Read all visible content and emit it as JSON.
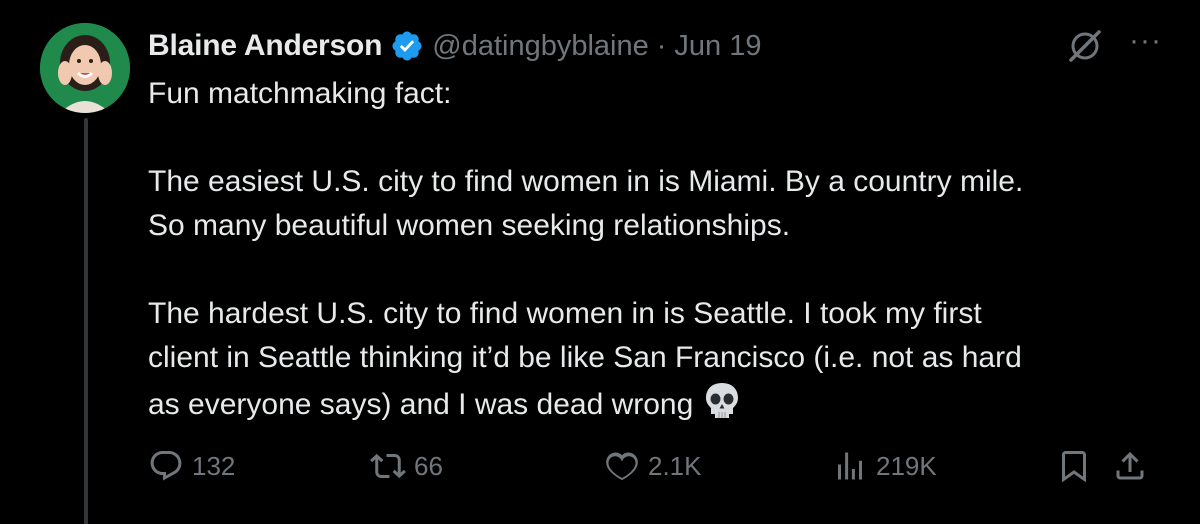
{
  "author": {
    "name": "Blaine Anderson",
    "handle": "@datingbyblaine",
    "separator": "·",
    "date": "Jun 19",
    "verified": true
  },
  "tweet": {
    "line1": "Fun matchmaking fact:",
    "para2_line1": "The easiest U.S. city to find women in is Miami. By a country mile.",
    "para2_line2": "So many beautiful women seeking relationships.",
    "para3_line1": "The hardest U.S. city to find women in is Seattle. I took my first",
    "para3_line2": "client in Seattle thinking it’d be like San Francisco (i.e. not as hard",
    "para3_line3": "as everyone says) and I was dead wrong",
    "emoji": "skull-emoji"
  },
  "stats": {
    "replies": "132",
    "reposts": "66",
    "likes": "2.1K",
    "views": "219K"
  },
  "icons": {
    "reply": "reply-icon",
    "repost": "repost-icon",
    "like": "heart-icon",
    "views": "views-icon",
    "bookmark": "bookmark-icon",
    "share": "share-icon",
    "grok": "grok-icon",
    "more": "more-icon"
  },
  "colors": {
    "background": "#000000",
    "text": "#e7e9ea",
    "muted": "#71767b",
    "verified": "#1d9bf0",
    "avatar_bg": "#1f8a4c"
  }
}
